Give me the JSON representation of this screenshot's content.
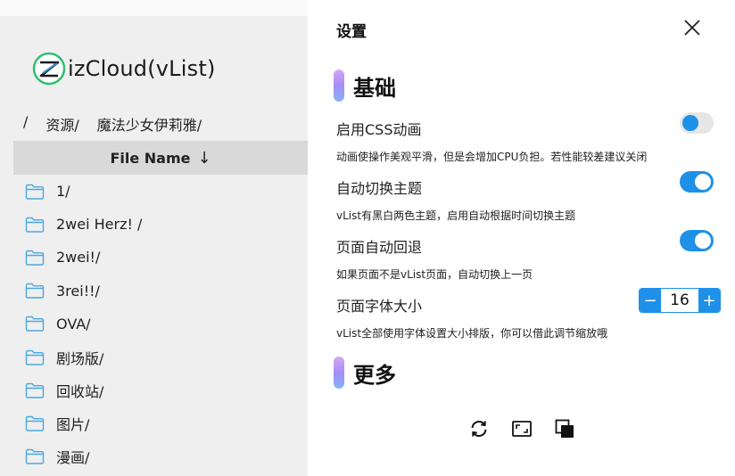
{
  "app": {
    "brand": "izCloud(vList)"
  },
  "breadcrumb": [
    "/",
    "资源/",
    "魔法少女伊莉雅/"
  ],
  "file_table": {
    "header": "File Name",
    "sort_arrow": "↓",
    "rows": [
      "1/",
      "2wei Herz! /",
      "2wei!/",
      "3rei!!/",
      "OVA/",
      "剧场版/",
      "回收站/",
      "图片/",
      "漫画/"
    ]
  },
  "settings": {
    "title": "设置",
    "section_basic": "基础",
    "section_more": "更多",
    "options": [
      {
        "label": "启用CSS动画",
        "desc": "动画使操作美观平滑，但是会增加CPU负担。若性能较差建议关闭",
        "enabled": false
      },
      {
        "label": "自动切换主题",
        "desc": "vList有黑白两色主题，启用自动根据时间切换主题",
        "enabled": true
      },
      {
        "label": "页面自动回退",
        "desc": "如果页面不是vList页面，自动切换上一页",
        "enabled": true
      }
    ],
    "font_size": {
      "label": "页面字体大小",
      "desc": "vList全部使用字体设置大小排版，你可以借此调节缩放哦",
      "value": "16",
      "minus": "−",
      "plus": "+"
    }
  },
  "colors": {
    "accent": "#1e90e8",
    "toggle_off_track": "#e6e6e6",
    "header_bg": "#d9d9d9"
  }
}
